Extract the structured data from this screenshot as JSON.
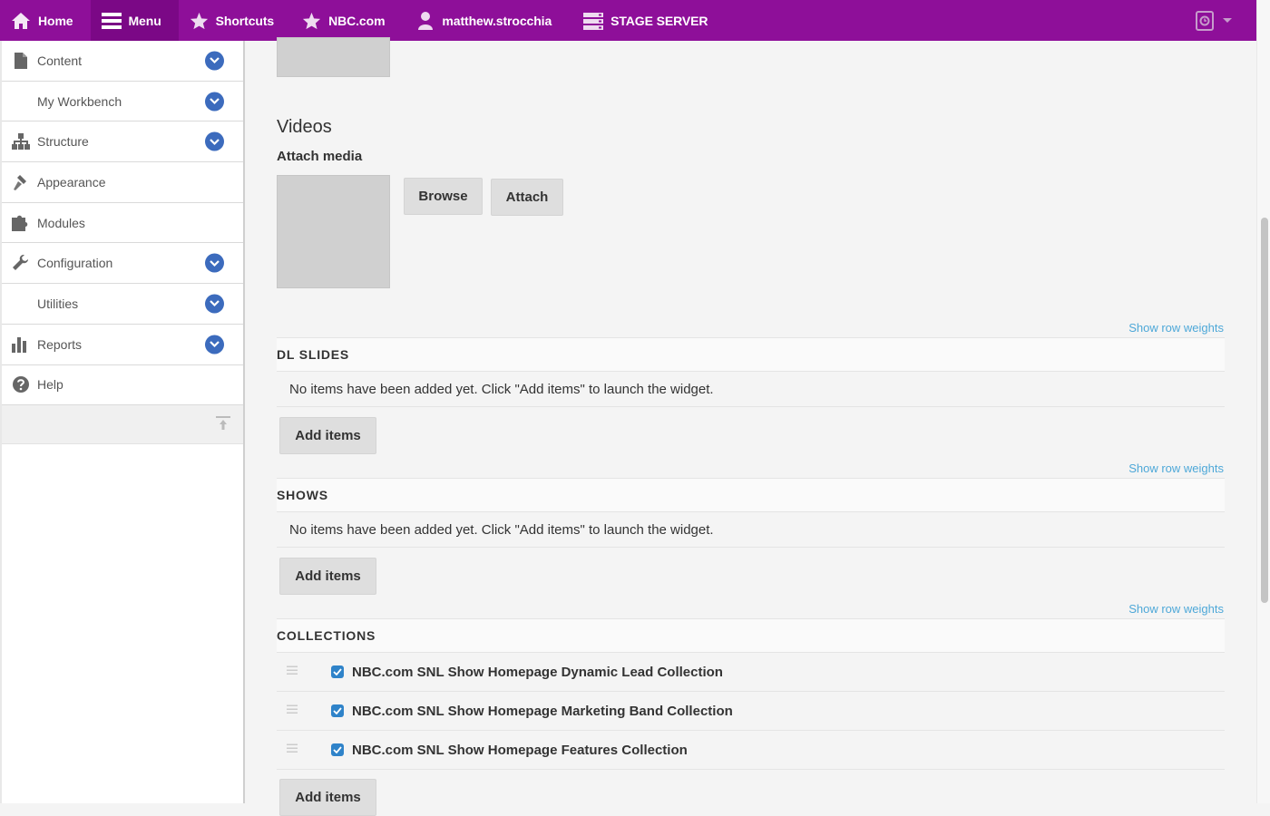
{
  "toolbar": {
    "home": "Home",
    "menu": "Menu",
    "shortcuts": "Shortcuts",
    "site": "NBC.com",
    "user": "matthew.strocchia",
    "server": "STAGE SERVER",
    "accent": "#8e0f99"
  },
  "sidebar": {
    "items": [
      {
        "label": "Content",
        "icon": "file-icon"
      },
      {
        "label": "My Workbench",
        "icon": ""
      },
      {
        "label": "Structure",
        "icon": "sitemap-icon"
      },
      {
        "label": "Appearance",
        "icon": "paintbrush-icon"
      },
      {
        "label": "Modules",
        "icon": "puzzle-icon"
      },
      {
        "label": "Configuration",
        "icon": "wrench-icon"
      },
      {
        "label": "Utilities",
        "icon": ""
      },
      {
        "label": "Reports",
        "icon": "bar-chart-icon"
      },
      {
        "label": "Help",
        "icon": "help-icon"
      }
    ]
  },
  "videos": {
    "heading": "Videos",
    "attach_label": "Attach media",
    "browse": "Browse",
    "attach": "Attach"
  },
  "sections": {
    "show_row_weights": "Show row weights",
    "add_items": "Add items",
    "empty_message": "No items have been added yet. Click \"Add items\" to launch the widget.",
    "dl_slides": "DL SLIDES",
    "shows": "SHOWS",
    "collections": "COLLECTIONS",
    "collection_items": [
      "NBC.com SNL Show Homepage Dynamic Lead Collection",
      "NBC.com SNL Show Homepage Marketing Band Collection",
      "NBC.com SNL Show Homepage Features Collection"
    ]
  }
}
